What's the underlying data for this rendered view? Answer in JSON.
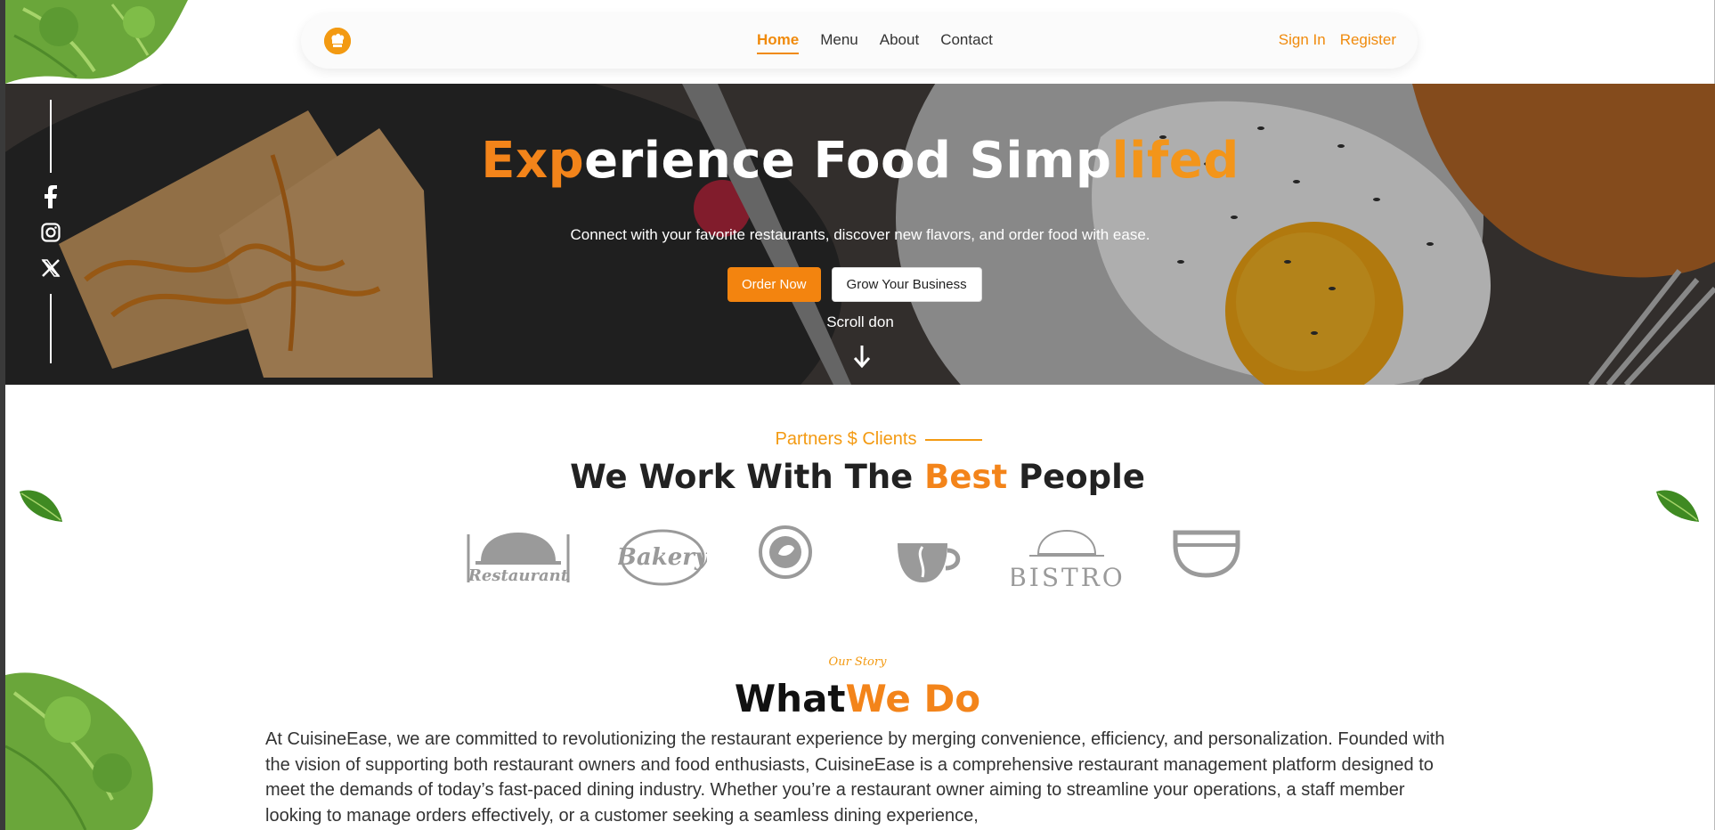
{
  "nav": {
    "logo_icon": "chef-hat-icon",
    "links": [
      {
        "label": "Home",
        "active": true
      },
      {
        "label": "Menu",
        "active": false
      },
      {
        "label": "About",
        "active": false
      },
      {
        "label": "Contact",
        "active": false
      }
    ],
    "sign_in": "Sign In",
    "register": "Register"
  },
  "hero": {
    "title_part1": "Exp",
    "title_part2": "erience Food Simp",
    "title_part3": "lifed",
    "subtitle": "Connect with your favorite restaurants, discover new flavors, and order food with ease.",
    "order_button": "Order Now",
    "grow_button": "Grow Your Business",
    "scroll_text": "Scroll don",
    "social_icons": [
      "facebook-icon",
      "instagram-icon",
      "x-icon"
    ]
  },
  "partners": {
    "label": "Partners $ Clients",
    "title_part1": "We Work With The ",
    "title_part2": "Best",
    "title_part3": " People",
    "logos": [
      "Restaurant",
      "Bakery",
      "Food Icon",
      "Cafe",
      "BISTRO",
      "Canteen"
    ]
  },
  "story": {
    "label": "Our Story",
    "title_part1": "What",
    "title_part2": "We Do",
    "text": "At CuisineEase, we are committed to revolutionizing the restaurant experience by merging convenience, efficiency, and personalization. Founded with the vision of supporting both restaurant owners and food enthusiasts, CuisineEase is a comprehensive restaurant management platform designed to meet the demands of today’s fast-paced dining industry. Whether you’re a restaurant owner aiming to streamline your operations, a staff member looking to manage orders effectively, or a customer seeking a seamless dining experience,"
  },
  "colors": {
    "accent": "#f3841a",
    "accent_light": "#f39a12"
  }
}
